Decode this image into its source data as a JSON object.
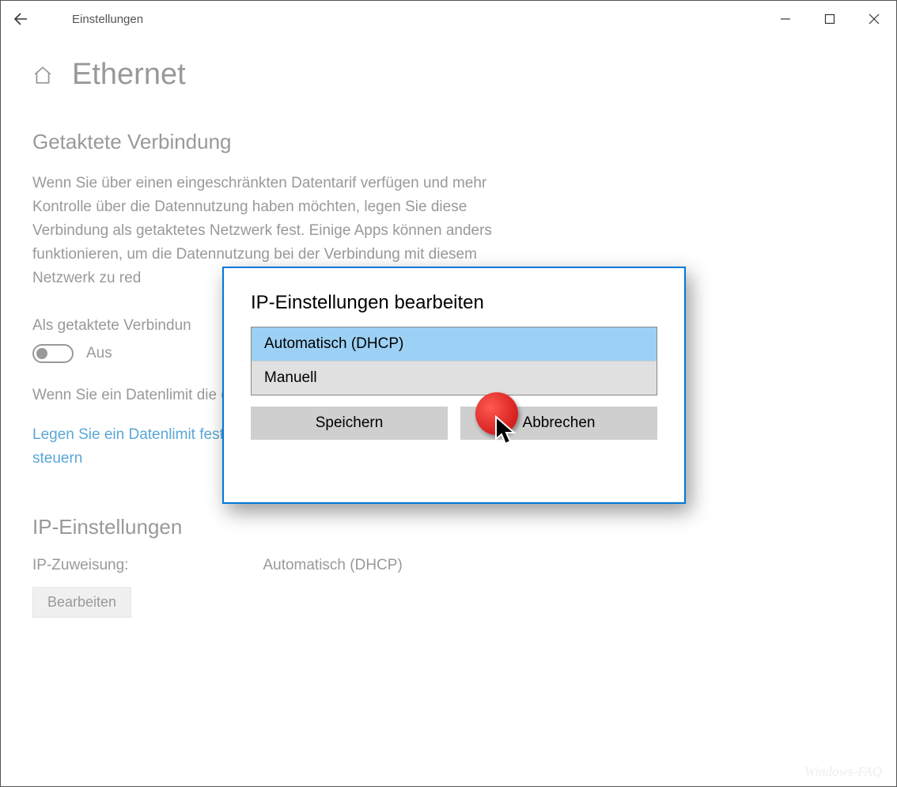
{
  "window": {
    "title": "Einstellungen"
  },
  "page": {
    "title": "Ethernet"
  },
  "metered": {
    "heading": "Getaktete Verbindung",
    "description": "Wenn Sie über einen eingeschränkten Datentarif verfügen und mehr Kontrolle über die Datennutzung haben möchten, legen Sie diese Verbindung als getaktetes Netzwerk fest. Einige Apps können anders funktionieren, um die Datennutzung bei der Verbindung mit diesem Netzwerk zu red",
    "toggle_label": "Als getaktete Verbindun",
    "toggle_state": "Aus",
    "limit_hint": "Wenn Sie ein Datenlimit die gemessene Verbindu bleiben.",
    "link": "Legen Sie ein Datenlimit fest, um die Datennutzung in diesem Netzwerk zu steuern"
  },
  "ip": {
    "heading": "IP-Einstellungen",
    "label": "IP-Zuweisung:",
    "value": "Automatisch (DHCP)",
    "edit": "Bearbeiten"
  },
  "dialog": {
    "title": "IP-Einstellungen bearbeiten",
    "options": [
      "Automatisch (DHCP)",
      "Manuell"
    ],
    "save": "Speichern",
    "cancel": "Abbrechen"
  },
  "watermark": "Windows-FAQ"
}
